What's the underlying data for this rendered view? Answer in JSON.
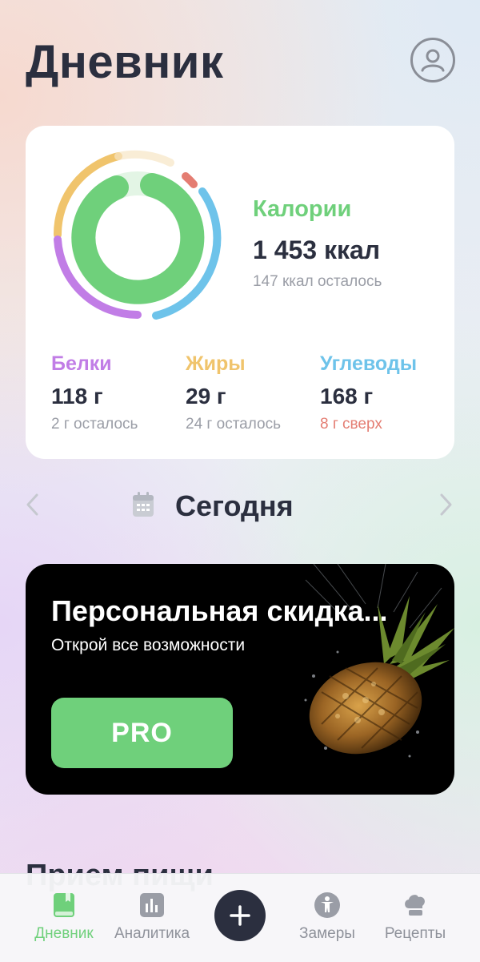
{
  "header": {
    "title": "Дневник"
  },
  "summary": {
    "calories": {
      "title": "Калории",
      "value": "1 453 ккал",
      "remaining": "147 ккал осталось",
      "progress": 0.91
    },
    "macros": [
      {
        "name": "Белки",
        "value": "118 г",
        "sub": "2 г осталось",
        "color": "#c17de6",
        "progress": 0.98
      },
      {
        "name": "Жиры",
        "value": "29 г",
        "sub": "24 г осталось",
        "color": "#f0c46c",
        "progress": 0.55
      },
      {
        "name": "Углеводы",
        "value": "168 г",
        "sub": "8 г сверх",
        "color": "#6ec3ea",
        "over_color": "#e47d72",
        "progress": 1.05
      }
    ],
    "accent": "#6fd07b"
  },
  "date_nav": {
    "label": "Сегодня",
    "prev_icon": "chevron-left-icon",
    "next_icon": "chevron-right-icon",
    "calendar_icon": "calendar-icon"
  },
  "promo": {
    "title": "Персональная скидка...",
    "subtitle": "Открой все возможности",
    "button_label": "PRO"
  },
  "section_heading": "Прием пищи",
  "tabbar": {
    "items": [
      {
        "label": "Дневник",
        "icon": "book-icon",
        "active": true
      },
      {
        "label": "Аналитика",
        "icon": "bar-chart-icon",
        "active": false
      },
      {
        "label": "Замеры",
        "icon": "body-icon",
        "active": false
      },
      {
        "label": "Рецепты",
        "icon": "chef-hat-icon",
        "active": false
      }
    ],
    "add_icon": "plus-icon"
  }
}
